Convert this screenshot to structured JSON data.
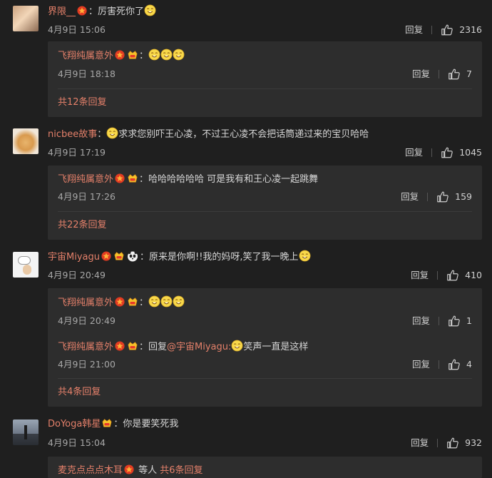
{
  "comments": [
    {
      "user": "界限__",
      "text": "：厉害死你了",
      "time": "4月9日 15:06",
      "reply_label": "回复",
      "likes": "2316",
      "replies": [
        {
          "user": "飞翔纯属意外",
          "text": "：",
          "time": "4月9日 18:18",
          "reply_label": "回复",
          "likes": "7"
        }
      ],
      "more": "共12条回复"
    },
    {
      "user": "nicbee故事",
      "text_prefix": "：",
      "text": "求求您别吓王心凌，不过王心凌不会把话筒递过来的宝贝哈哈",
      "time": "4月9日 17:19",
      "reply_label": "回复",
      "likes": "1045",
      "replies": [
        {
          "user": "飞翔纯属意外",
          "text": "：哈哈哈哈哈哈 可是我有和王心凌一起跳舞",
          "time": "4月9日 17:26",
          "reply_label": "回复",
          "likes": "159"
        }
      ],
      "more": "共22条回复"
    },
    {
      "user": "宇宙Miyagu",
      "text": "：原来是你啊!!我的妈呀,笑了我一晚上",
      "time": "4月9日 20:49",
      "reply_label": "回复",
      "likes": "410",
      "replies": [
        {
          "user": "飞翔纯属意外",
          "text": "：",
          "time": "4月9日 20:49",
          "reply_label": "回复",
          "likes": "1"
        },
        {
          "user": "飞翔纯属意外",
          "text_prefix": "：回复",
          "mention": "@宇宙Miyagu",
          "text_mid": ":",
          "text": "笑声一直是这样",
          "time": "4月9日 21:00",
          "reply_label": "回复",
          "likes": "4"
        }
      ],
      "more": "共4条回复"
    },
    {
      "user": "DoYoga韩星",
      "text": "：你是要笑死我",
      "time": "4月9日 15:04",
      "reply_label": "回复",
      "likes": "932",
      "partial_reply": {
        "user": "麦克点点点木耳",
        "text": " 等人 ",
        "more": "共6条回复"
      }
    }
  ],
  "colors": {
    "username": "#e4806a",
    "background": "#1f1f1f",
    "reply_box": "#2d2d2d"
  },
  "icons": [
    "like-icon",
    "star-badge-icon",
    "vip-badge-icon",
    "emoji-icon",
    "panda-emoji-icon"
  ]
}
